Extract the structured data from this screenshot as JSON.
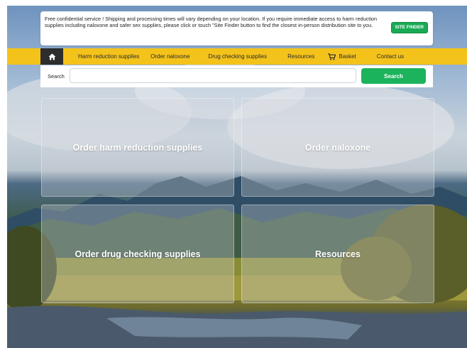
{
  "notice": {
    "text": "Free confidential service ! Shipping and processing times will vary depending on your location. If you require immediate access to harm reduction supplies including naloxone and safer sex supplies, please click or touch \"Site Finder button to find the closest in-person distribution site to you.",
    "site_finder_label": "SITE FINDER"
  },
  "nav": {
    "home_icon": "home-icon",
    "items": [
      {
        "label": "Harm reduction supplies"
      },
      {
        "label": "Order naloxone"
      },
      {
        "label": "Drug checking supplies"
      },
      {
        "label": "Resources"
      },
      {
        "label": "Basket",
        "icon": "cart-icon"
      },
      {
        "label": "Contact us"
      }
    ]
  },
  "search": {
    "label": "Search",
    "value": "",
    "button_label": "Search"
  },
  "tiles": [
    {
      "label": "Order harm reduction supplies"
    },
    {
      "label": "Order naloxone"
    },
    {
      "label": "Order drug checking supplies"
    },
    {
      "label": "Resources"
    }
  ],
  "colors": {
    "nav_bg": "#f4c31b",
    "accent_green": "#1bb35c",
    "home_bg": "#2d2d2d"
  }
}
